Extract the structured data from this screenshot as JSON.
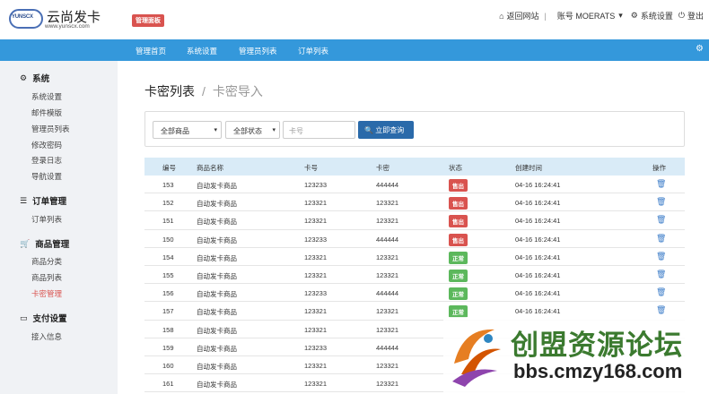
{
  "header": {
    "logo_text": "YUNSCX",
    "brand": "云尚发卡",
    "url": "www.yunscx.com",
    "badge": "管理面板",
    "links": [
      {
        "label": "返回网站",
        "icon": "home-icon"
      },
      {
        "label": "账号 MOERATS",
        "icon": "caret-down-icon"
      },
      {
        "label": "系统设置",
        "icon": "gear-icon"
      },
      {
        "label": "登出",
        "icon": "power-icon"
      }
    ]
  },
  "nav": {
    "items": [
      "管理首页",
      "系统设置",
      "管理员列表",
      "订单列表"
    ]
  },
  "sidebar": {
    "sections": [
      {
        "title": "系统",
        "icon": "gear-icon",
        "items": [
          "系统设置",
          "邮件模版",
          "管理员列表",
          "修改密码",
          "登录日志",
          "导航设置"
        ]
      },
      {
        "title": "订单管理",
        "icon": "list-icon",
        "items": [
          "订单列表"
        ]
      },
      {
        "title": "商品管理",
        "icon": "cart-icon",
        "items": [
          "商品分类",
          "商品列表",
          "卡密管理"
        ]
      },
      {
        "title": "支付设置",
        "icon": "credit-card-icon",
        "items": [
          "接入信息"
        ]
      }
    ],
    "active_item": "卡密管理"
  },
  "page": {
    "title": "卡密列表",
    "subtitle": "卡密导入"
  },
  "filter": {
    "product_select": "全部商品",
    "status_select": "全部状态",
    "card_placeholder": "卡号",
    "query_button": "立即查询"
  },
  "table": {
    "headers": [
      "编号",
      "商品名称",
      "卡号",
      "卡密",
      "状态",
      "创建时间",
      "操作"
    ],
    "rows": [
      {
        "id": "153",
        "product": "自动发卡商品",
        "card": "123233",
        "secret": "444444",
        "status": "售出",
        "time": "04-16 16:24:41"
      },
      {
        "id": "152",
        "product": "自动发卡商品",
        "card": "123321",
        "secret": "123321",
        "status": "售出",
        "time": "04-16 16:24:41"
      },
      {
        "id": "151",
        "product": "自动发卡商品",
        "card": "123321",
        "secret": "123321",
        "status": "售出",
        "time": "04-16 16:24:41"
      },
      {
        "id": "150",
        "product": "自动发卡商品",
        "card": "123233",
        "secret": "444444",
        "status": "售出",
        "time": "04-16 16:24:41"
      },
      {
        "id": "154",
        "product": "自动发卡商品",
        "card": "123321",
        "secret": "123321",
        "status": "正常",
        "time": "04-16 16:24:41"
      },
      {
        "id": "155",
        "product": "自动发卡商品",
        "card": "123321",
        "secret": "123321",
        "status": "正常",
        "time": "04-16 16:24:41"
      },
      {
        "id": "156",
        "product": "自动发卡商品",
        "card": "123233",
        "secret": "444444",
        "status": "正常",
        "time": "04-16 16:24:41"
      },
      {
        "id": "157",
        "product": "自动发卡商品",
        "card": "123321",
        "secret": "123321",
        "status": "正常",
        "time": "04-16 16:24:41"
      },
      {
        "id": "158",
        "product": "自动发卡商品",
        "card": "123321",
        "secret": "123321",
        "status": "",
        "time": ""
      },
      {
        "id": "159",
        "product": "自动发卡商品",
        "card": "123233",
        "secret": "444444",
        "status": "",
        "time": ""
      },
      {
        "id": "160",
        "product": "自动发卡商品",
        "card": "123321",
        "secret": "123321",
        "status": "",
        "time": ""
      },
      {
        "id": "161",
        "product": "自动发卡商品",
        "card": "123321",
        "secret": "123321",
        "status": "",
        "time": ""
      }
    ]
  },
  "status_colors": {
    "售出": "#d9534f",
    "正常": "#5cb85c"
  },
  "watermark": {
    "title": "创盟资源论坛",
    "url": "bbs.cmzy168.com"
  }
}
